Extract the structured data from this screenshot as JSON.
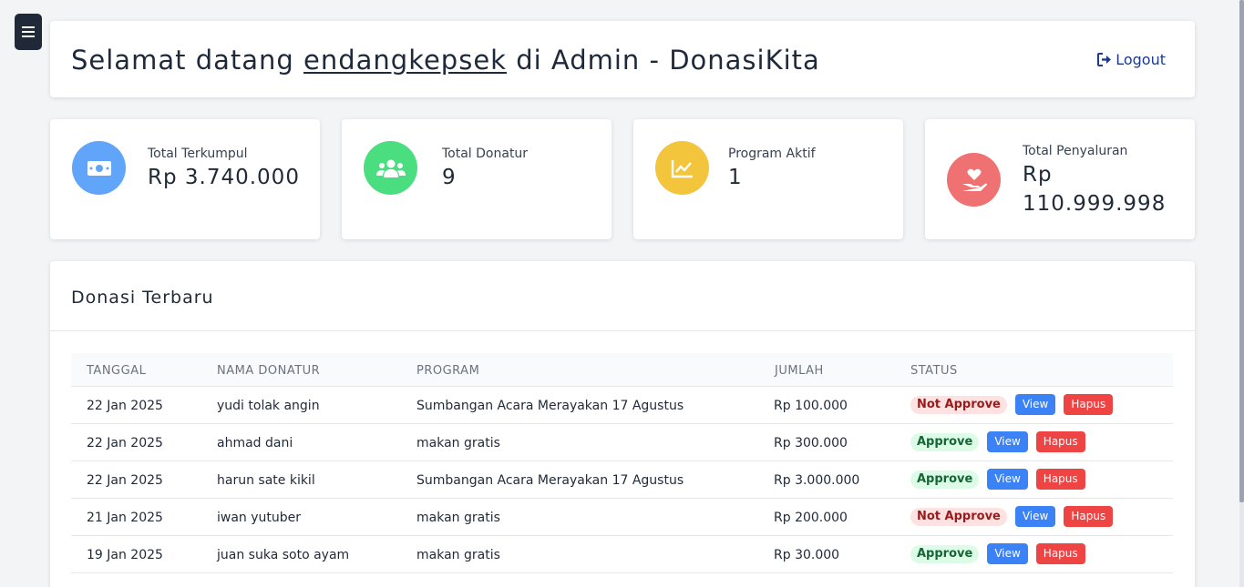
{
  "header": {
    "welcome_prefix": "Selamat datang",
    "username": "endangkepsek",
    "welcome_suffix": "di Admin - DonasiKita",
    "logout_label": "Logout"
  },
  "stats": [
    {
      "label": "Total Terkumpul",
      "value": "Rp 3.740.000",
      "icon": "money-bill-icon",
      "color": "#60a5fa"
    },
    {
      "label": "Total Donatur",
      "value": "9",
      "icon": "users-icon",
      "color": "#4ade80"
    },
    {
      "label": "Program Aktif",
      "value": "1",
      "icon": "chart-line-icon",
      "color": "#f2c53d"
    },
    {
      "label": "Total Penyaluran",
      "value": "Rp 110.999.998",
      "icon": "hand-holding-heart-icon",
      "color": "#f07171"
    }
  ],
  "donations": {
    "title": "Donasi Terbaru",
    "columns": [
      "TANGGAL",
      "NAMA DONATUR",
      "PROGRAM",
      "JUMLAH",
      "STATUS"
    ],
    "view_label": "View",
    "delete_label": "Hapus",
    "rows": [
      {
        "date": "22 Jan 2025",
        "name": "yudi tolak angin",
        "program": "Sumbangan Acara Merayakan 17 Agustus",
        "amount": "Rp 100.000",
        "status": "Not Approve"
      },
      {
        "date": "22 Jan 2025",
        "name": "ahmad dani",
        "program": "makan gratis",
        "amount": "Rp 300.000",
        "status": "Approve"
      },
      {
        "date": "22 Jan 2025",
        "name": "harun sate kikil",
        "program": "Sumbangan Acara Merayakan 17 Agustus",
        "amount": "Rp 3.000.000",
        "status": "Approve"
      },
      {
        "date": "21 Jan 2025",
        "name": "iwan yutuber",
        "program": "makan gratis",
        "amount": "Rp 200.000",
        "status": "Not Approve"
      },
      {
        "date": "19 Jan 2025",
        "name": "juan suka soto ayam",
        "program": "makan gratis",
        "amount": "Rp 30.000",
        "status": "Approve"
      }
    ]
  }
}
